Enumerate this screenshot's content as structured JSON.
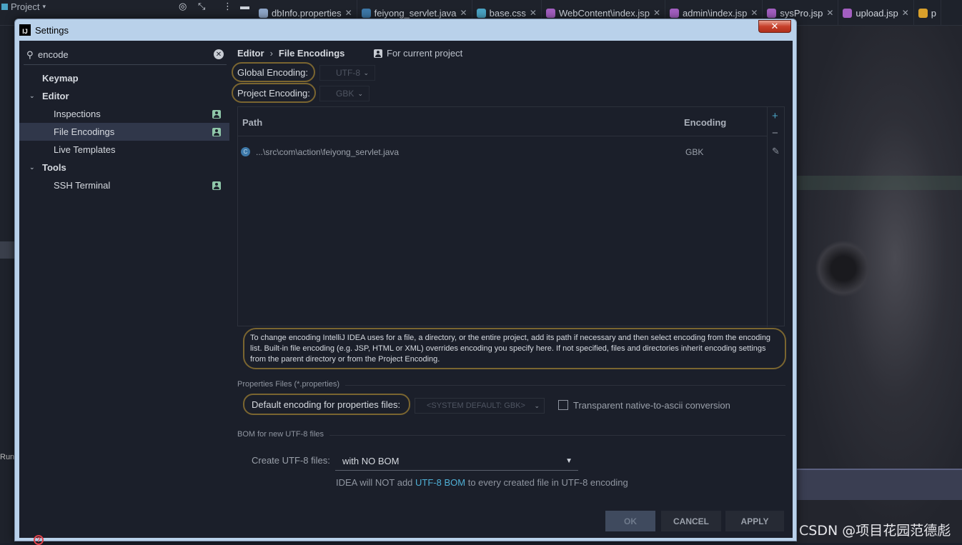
{
  "ide": {
    "project_label": "Project",
    "tabs": [
      {
        "label": "dbInfo.properties",
        "icon": "code-icon",
        "color": "#8fa7c9"
      },
      {
        "label": "feiyong_servlet.java",
        "icon": "class-icon",
        "color": "#3d78a8"
      },
      {
        "label": "base.css",
        "icon": "css-icon",
        "color": "#4aa3c4"
      },
      {
        "label": "WebContent\\index.jsp",
        "icon": "jsp-icon",
        "color": "#a35fc1"
      },
      {
        "label": "admin\\index.jsp",
        "icon": "jsp-icon",
        "color": "#a35fc1"
      },
      {
        "label": "sysPro.jsp",
        "icon": "jsp-icon",
        "color": "#a35fc1"
      },
      {
        "label": "upload.jsp",
        "icon": "jsp-icon",
        "color": "#a35fc1"
      },
      {
        "label": "p",
        "icon": "js-icon",
        "color": "#d9a02b"
      }
    ],
    "run_label": "Run:",
    "watermark": "CSDN @项目花园范德彪"
  },
  "dialog": {
    "title": "Settings",
    "logo_text": "IJ",
    "close_glyph": "✕"
  },
  "search": {
    "value": "encode"
  },
  "tree": [
    {
      "label": "Keymap",
      "bold": true
    },
    {
      "label": "Editor",
      "bold": true,
      "arrow": "⌄"
    },
    {
      "label": "Inspections",
      "badge": true
    },
    {
      "label": "File Encodings",
      "badge": true,
      "selected": true
    },
    {
      "label": "Live Templates"
    },
    {
      "label": "Tools",
      "bold": true,
      "arrow": "⌄"
    },
    {
      "label": "SSH Terminal",
      "badge": true
    }
  ],
  "crumb": {
    "parent": "Editor",
    "separator": "›",
    "current": "File Encodings",
    "scope": "For current project"
  },
  "global_encoding": {
    "label": "Global Encoding:",
    "value": "UTF-8"
  },
  "project_encoding": {
    "label": "Project Encoding:",
    "value": "GBK"
  },
  "table": {
    "col_path": "Path",
    "col_encoding": "Encoding",
    "rows": [
      {
        "icon": "C",
        "path": "...\\src\\com\\action\\feiyong_servlet.java",
        "encoding": "GBK"
      }
    ]
  },
  "info_text": "To change encoding IntelliJ IDEA uses for a file, a directory, or the entire project, add its path if necessary and then select encoding from the encoding list. Built-in file encoding (e.g. JSP, HTML or XML) overrides encoding you specify here. If not specified, files and directories inherit encoding settings from the parent directory or from the Project Encoding.",
  "properties": {
    "section": "Properties Files (*.properties)",
    "default_label": "Default encoding for properties files:",
    "default_value": "<SYSTEM DEFAULT: GBK>",
    "native_label": "Transparent native-to-ascii conversion"
  },
  "bom": {
    "section": "BOM for new UTF-8 files",
    "create_label": "Create UTF-8 files:",
    "create_value": "with NO BOM",
    "hint_pre": "IDEA will NOT add ",
    "hint_link": "UTF-8 BOM",
    "hint_post": " to every created file in UTF-8 encoding"
  },
  "buttons": {
    "ok": "OK",
    "cancel": "CANCEL",
    "apply": "APPLY"
  },
  "help_glyph": "?"
}
